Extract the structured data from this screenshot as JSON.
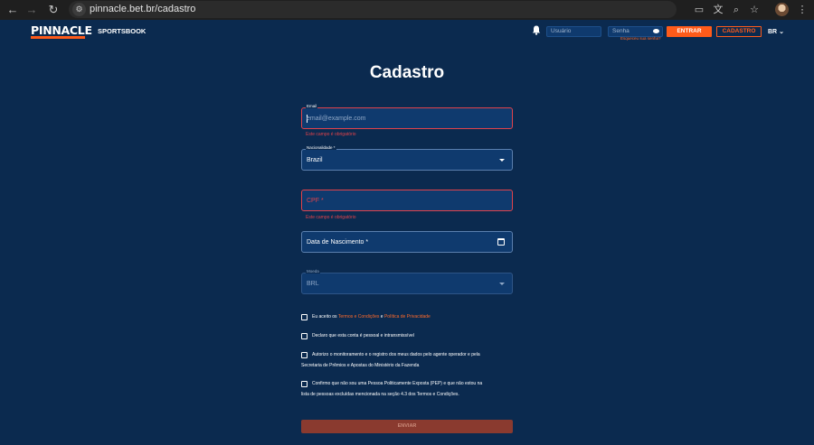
{
  "browser": {
    "url": "pinnacle.bet.br/cadastro"
  },
  "header": {
    "logo": "PINNACLE",
    "sportsbook_label": "SPORTSBOOK",
    "username_placeholder": "Usuário",
    "password_placeholder": "Senha",
    "forgot_link": "Esqueceu sua senha?",
    "login_button": "ENTRAR",
    "register_button": "CADASTRO",
    "language": "BR"
  },
  "form": {
    "title": "Cadastro",
    "email": {
      "label": "Email",
      "placeholder": "email@example.com",
      "error": "Este campo é obrigatório"
    },
    "nationality": {
      "label": "Nacionalidade *",
      "value": "Brazil"
    },
    "cpf": {
      "placeholder": "CPF *",
      "error": "Este campo é obrigatório"
    },
    "birthdate": {
      "placeholder": "Data de Nascimento *"
    },
    "currency": {
      "label": "Moeda",
      "value": "BRL"
    },
    "checks": {
      "terms_prefix": "Eu aceito os ",
      "terms_link": "Termos e Condições",
      "terms_and": " e ",
      "privacy_link": "Política de Privacidade",
      "personal": "Declaro que esta conta é pessoal e intransmissível",
      "monitoring_line1": "Autorizo o monitoramento e o registro dos meus dados pelo agente operador e pela",
      "monitoring_line2": "Secretaria de Prêmios e Apostas do Ministério da Fazenda",
      "pep_line1": "Confirmo que não sou uma Pessoa Politicamente Exposta (PEP) e que não estou na",
      "pep_line2": "lista de pessoas excluídas mencionada na seção 4.3 dos Termos e Condições."
    },
    "submit": "ENVIAR"
  },
  "colors": {
    "background": "#0b2a4f",
    "accent": "#ff5b1a",
    "error": "#e2434b"
  }
}
